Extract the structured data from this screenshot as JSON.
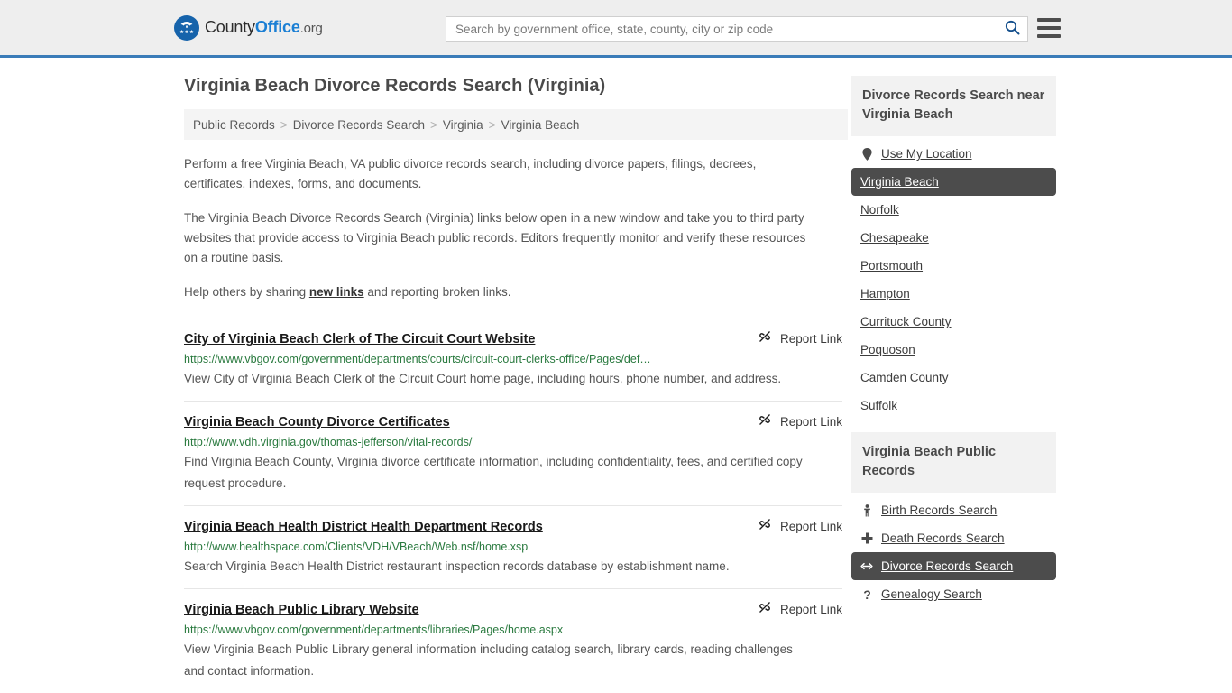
{
  "header": {
    "logo": {
      "icon": "eagle-shield-logo",
      "part1": "County",
      "part2": "Office",
      "part3": ".org"
    },
    "search": {
      "placeholder": "Search by government office, state, county, city or zip code",
      "value": "",
      "search_icon": "search-icon"
    },
    "menu_icon": "hamburger-menu-icon",
    "accent_color": "#3a7cb8",
    "background_color": "#eeeeee"
  },
  "page": {
    "title": "Virginia Beach Divorce Records Search (Virginia)"
  },
  "breadcrumb": {
    "separator": ">",
    "items": [
      {
        "label": "Public Records"
      },
      {
        "label": "Divorce Records Search"
      },
      {
        "label": "Virginia"
      },
      {
        "label": "Virginia Beach"
      }
    ]
  },
  "intro": {
    "paragraph1": "Perform a free Virginia Beach, VA public divorce records search, including divorce papers, filings, decrees, certificates, indexes, forms, and documents.",
    "paragraph2": "The Virginia Beach Divorce Records Search (Virginia) links below open in a new window and take you to third party websites that provide access to Virginia Beach public records. Editors frequently monitor and verify these resources on a routine basis.",
    "paragraph3_before": "Help others by sharing ",
    "paragraph3_link": "new links",
    "paragraph3_after": " and reporting broken links."
  },
  "results": {
    "report_label": "Report Link",
    "report_icon": "broken-link-icon",
    "items": [
      {
        "title": "City of Virginia Beach Clerk of The Circuit Court Website",
        "url": "https://www.vbgov.com/government/departments/courts/circuit-court-clerks-office/Pages/def…",
        "description": "View City of Virginia Beach Clerk of the Circuit Court home page, including hours, phone number, and address."
      },
      {
        "title": "Virginia Beach County Divorce Certificates",
        "url": "http://www.vdh.virginia.gov/thomas-jefferson/vital-records/",
        "description": "Find Virginia Beach County, Virginia divorce certificate information, including confidentiality, fees, and certified copy request procedure."
      },
      {
        "title": "Virginia Beach Health District Health Department Records",
        "url": "http://www.healthspace.com/Clients/VDH/VBeach/Web.nsf/home.xsp",
        "description": "Search Virginia Beach Health District restaurant inspection records database by establishment name."
      },
      {
        "title": "Virginia Beach Public Library Website",
        "url": "https://www.vbgov.com/government/departments/libraries/Pages/home.aspx",
        "description": "View Virginia Beach Public Library general information including catalog search, library cards, reading challenges and contact information."
      }
    ]
  },
  "sidebar": {
    "nearby": {
      "heading": "Divorce Records Search near Virginia Beach",
      "items": [
        {
          "label": "Use My Location",
          "icon": "map-pin-icon",
          "active": false
        },
        {
          "label": "Virginia Beach",
          "icon": "",
          "active": true
        },
        {
          "label": "Norfolk",
          "icon": "",
          "active": false
        },
        {
          "label": "Chesapeake",
          "icon": "",
          "active": false
        },
        {
          "label": "Portsmouth",
          "icon": "",
          "active": false
        },
        {
          "label": "Hampton",
          "icon": "",
          "active": false
        },
        {
          "label": "Currituck County",
          "icon": "",
          "active": false
        },
        {
          "label": "Poquoson",
          "icon": "",
          "active": false
        },
        {
          "label": "Camden County",
          "icon": "",
          "active": false
        },
        {
          "label": "Suffolk",
          "icon": "",
          "active": false
        }
      ]
    },
    "public_records": {
      "heading": "Virginia Beach Public Records",
      "items": [
        {
          "label": "Birth Records Search",
          "icon": "baby-icon",
          "active": false
        },
        {
          "label": "Death Records Search",
          "icon": "cross-icon",
          "active": false
        },
        {
          "label": "Divorce Records Search",
          "icon": "split-arrows-icon",
          "active": true
        },
        {
          "label": "Genealogy Search",
          "icon": "question-mark-icon",
          "active": false
        }
      ]
    },
    "active_highlight_color": "#4c4c4c"
  }
}
